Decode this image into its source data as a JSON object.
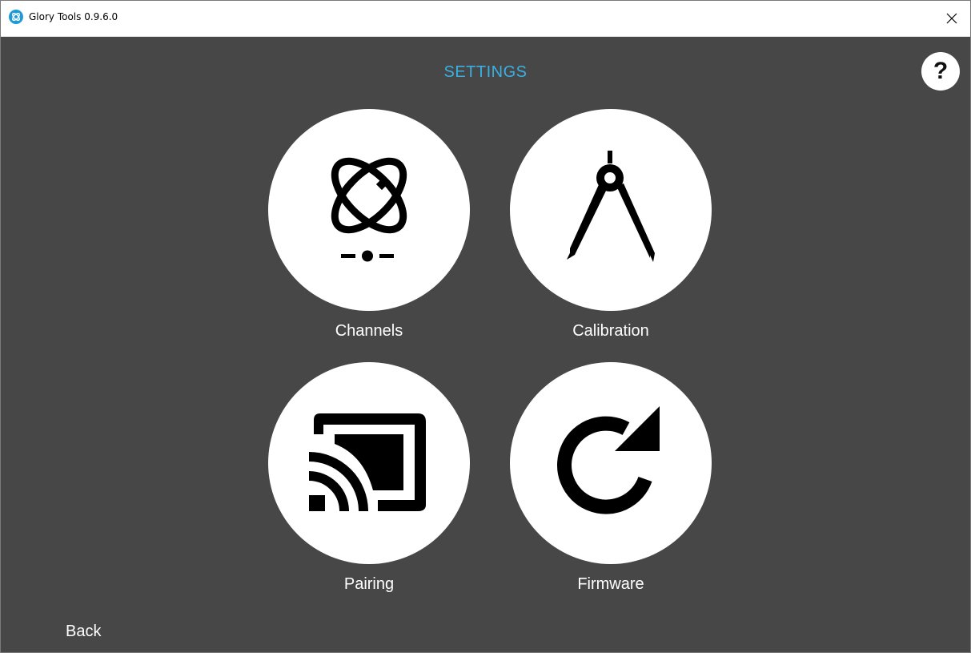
{
  "window": {
    "title": "Glory Tools 0.9.6.0",
    "app_icon": "glory-logo-icon",
    "close_icon": "close-icon"
  },
  "page": {
    "title": "SETTINGS",
    "help_label": "?"
  },
  "tiles": [
    {
      "label": "Channels",
      "icon": "channels-atom-icon"
    },
    {
      "label": "Calibration",
      "icon": "compass-icon"
    },
    {
      "label": "Pairing",
      "icon": "cast-icon"
    },
    {
      "label": "Firmware",
      "icon": "refresh-icon"
    }
  ],
  "footer": {
    "back_label": "Back"
  },
  "colors": {
    "background": "#474747",
    "title_accent": "#3ab0e2",
    "tile_fill": "#ffffff",
    "icon": "#000000"
  }
}
